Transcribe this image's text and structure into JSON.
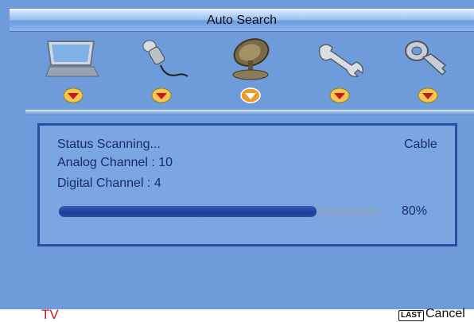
{
  "title": "Auto Search",
  "menu_icons": [
    {
      "name": "monitor-icon"
    },
    {
      "name": "microphone-icon"
    },
    {
      "name": "satellite-dish-icon"
    },
    {
      "name": "wrench-icon"
    },
    {
      "name": "key-icon"
    }
  ],
  "scan": {
    "status_label": "Status Scanning...",
    "source": "Cable",
    "analog_label": "Analog Channel : 10",
    "digital_label": "Digital Channel : 4",
    "progress_percent": 80,
    "progress_text": "80%"
  },
  "footer": {
    "input_source": "TV",
    "last_key": "LAST",
    "cancel_label": "Cancel"
  },
  "colors": {
    "background": "#6e9bd9",
    "panel_border": "#2a4fa0",
    "progress_fill": "#1d3c96",
    "tv_label": "#cc1a1a",
    "arrow_active": "#f09a2a",
    "arrow_inactive": "#f2c84a"
  }
}
